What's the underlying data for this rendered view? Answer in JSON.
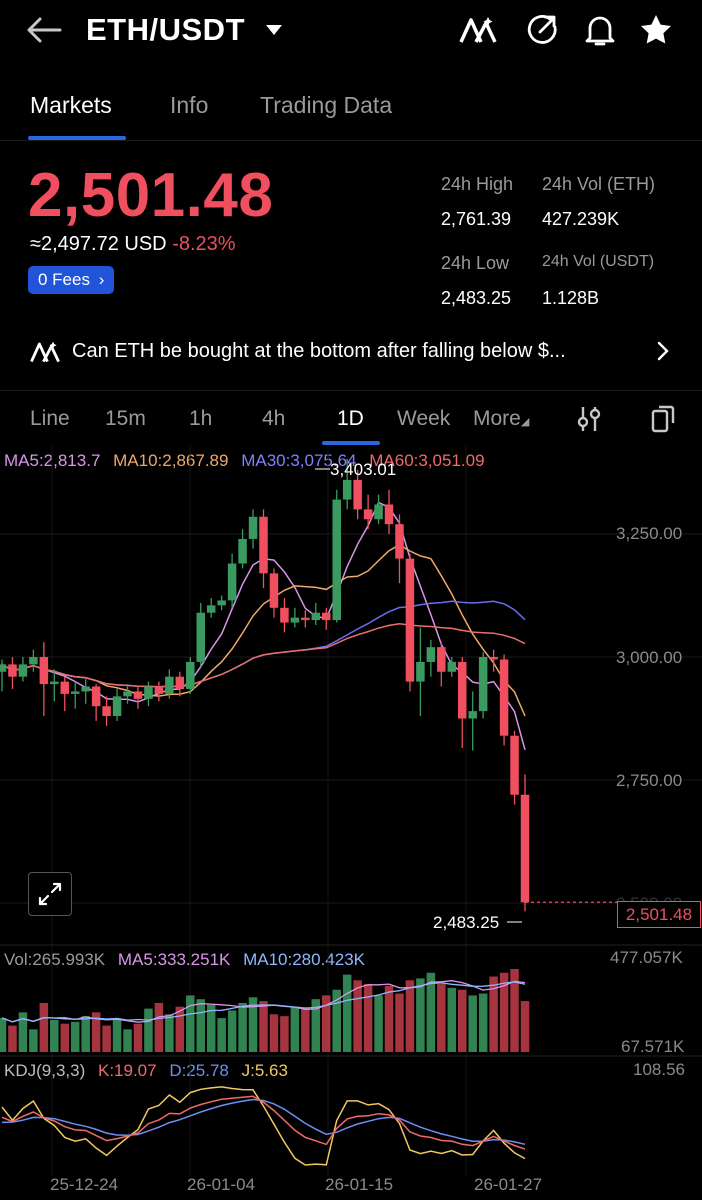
{
  "header": {
    "pair": "ETH/USDT"
  },
  "tabs": [
    "Markets",
    "Info",
    "Trading Data"
  ],
  "ticker": {
    "price": "2,501.48",
    "usd_approx": "≈2,497.72 USD",
    "change": "-8.23%",
    "fees_label": "0 Fees",
    "high_label": "24h High",
    "high_value": "2,761.39",
    "low_label": "24h Low",
    "low_value": "2,483.25",
    "vol_eth_label": "24h Vol (ETH)",
    "vol_eth_value": "427.239K",
    "vol_usdt_label": "24h Vol  (USDT)",
    "vol_usdt_value": "1.128B"
  },
  "news": {
    "text": "Can ETH be bought at the bottom after falling below $..."
  },
  "intervals": [
    "Line",
    "15m",
    "1h",
    "4h",
    "1D",
    "Week",
    "More"
  ],
  "indicators": {
    "ma5": "MA5:2,813.7",
    "ma10": "MA10:2,867.89",
    "ma30": "MA30:3,075.64",
    "ma60": "MA60:3,051.09",
    "vol": "Vol:265.993K",
    "vol_ma5": "MA5:333.251K",
    "vol_ma10": "MA10:280.423K",
    "kdj": "KDJ(9,3,3)",
    "k": "K:19.07",
    "d": "D:25.78",
    "j": "J:5.63"
  },
  "chart_data": {
    "type": "candlestick",
    "price_axis": [
      "3,250.00",
      "3,000.00",
      "2,750.00",
      "2,500.00"
    ],
    "last_price_tag": "2,501.48",
    "high_marker": "3,403.01",
    "low_marker": "2,483.25",
    "volume_axis": [
      "477.057K",
      "67.571K"
    ],
    "kdj_axis": "108.56",
    "dates": [
      "25-12-24",
      "26-01-04",
      "26-01-15",
      "26-01-27"
    ],
    "ylim": [
      2483.25,
      3403.01
    ],
    "candles": [
      [
        2970,
        2985,
        2930,
        2995
      ],
      [
        2985,
        2960,
        2935,
        3000
      ],
      [
        2960,
        2985,
        2950,
        3000
      ],
      [
        2985,
        3000,
        2970,
        3015
      ],
      [
        3000,
        2945,
        2880,
        3030
      ],
      [
        2945,
        2950,
        2910,
        2975
      ],
      [
        2950,
        2925,
        2890,
        2960
      ],
      [
        2925,
        2930,
        2895,
        2950
      ],
      [
        2930,
        2940,
        2905,
        2955
      ],
      [
        2940,
        2900,
        2870,
        2945
      ],
      [
        2900,
        2880,
        2860,
        2920
      ],
      [
        2880,
        2920,
        2870,
        2935
      ],
      [
        2920,
        2930,
        2905,
        2945
      ],
      [
        2930,
        2915,
        2895,
        2940
      ],
      [
        2915,
        2940,
        2900,
        2950
      ],
      [
        2940,
        2925,
        2910,
        2950
      ],
      [
        2925,
        2960,
        2915,
        2975
      ],
      [
        2960,
        2935,
        2920,
        2970
      ],
      [
        2935,
        2990,
        2925,
        3000
      ],
      [
        2990,
        3090,
        2980,
        3110
      ],
      [
        3090,
        3105,
        3080,
        3120
      ],
      [
        3105,
        3115,
        3095,
        3125
      ],
      [
        3115,
        3190,
        3100,
        3210
      ],
      [
        3190,
        3240,
        3180,
        3260
      ],
      [
        3240,
        3285,
        3220,
        3300
      ],
      [
        3285,
        3170,
        3140,
        3300
      ],
      [
        3170,
        3100,
        3080,
        3180
      ],
      [
        3100,
        3070,
        3050,
        3120
      ],
      [
        3070,
        3080,
        3060,
        3100
      ],
      [
        3080,
        3075,
        3060,
        3095
      ],
      [
        3075,
        3090,
        3065,
        3110
      ],
      [
        3090,
        3075,
        3055,
        3100
      ],
      [
        3075,
        3320,
        3070,
        3340
      ],
      [
        3320,
        3360,
        3300,
        3403.01
      ],
      [
        3360,
        3300,
        3280,
        3380
      ],
      [
        3300,
        3280,
        3260,
        3330
      ],
      [
        3280,
        3310,
        3270,
        3330
      ],
      [
        3310,
        3270,
        3250,
        3340
      ],
      [
        3270,
        3200,
        3150,
        3290
      ],
      [
        3200,
        2950,
        2930,
        3210
      ],
      [
        2950,
        2990,
        2880,
        3060
      ],
      [
        2990,
        3020,
        2960,
        3035
      ],
      [
        3020,
        2970,
        2940,
        3030
      ],
      [
        2970,
        2990,
        2960,
        3000
      ],
      [
        2990,
        2875,
        2815,
        3000
      ],
      [
        2875,
        2890,
        2810,
        2930
      ],
      [
        2890,
        3000,
        2875,
        3010
      ],
      [
        3000,
        2995,
        2970,
        3015
      ],
      [
        2995,
        2840,
        2820,
        3005
      ],
      [
        2840,
        2720,
        2700,
        2850
      ],
      [
        2720,
        2501.48,
        2483.25,
        2761.39
      ]
    ],
    "volumes": [
      180,
      140,
      210,
      120,
      260,
      170,
      150,
      160,
      190,
      210,
      140,
      170,
      120,
      150,
      230,
      260,
      200,
      240,
      300,
      280,
      250,
      180,
      220,
      260,
      290,
      270,
      200,
      190,
      240,
      230,
      280,
      300,
      330,
      410,
      380,
      360,
      300,
      350,
      310,
      380,
      390,
      420,
      360,
      340,
      330,
      300,
      310,
      400,
      420,
      440,
      270
    ],
    "ma_series": [
      {
        "name": "MA5",
        "color": "#d996e8"
      },
      {
        "name": "MA10",
        "color": "#f0a868"
      },
      {
        "name": "MA30",
        "color": "#6c6cf0"
      },
      {
        "name": "MA60",
        "color": "#e8706e"
      }
    ],
    "up_color": "#3b9a60",
    "down_color": "#ef4f5f"
  }
}
